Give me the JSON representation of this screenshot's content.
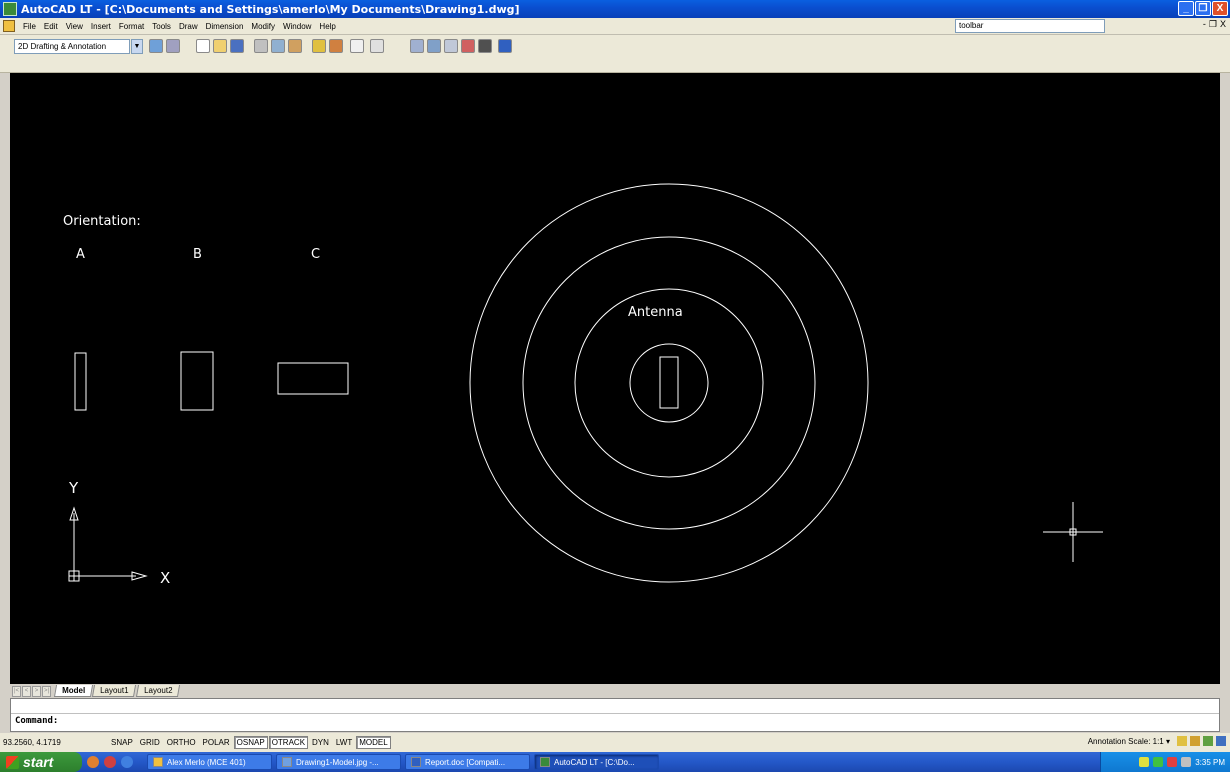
{
  "window": {
    "title": "AutoCAD LT - [C:\\Documents and Settings\\amerlo\\My Documents\\Drawing1.dwg]",
    "buttons": [
      "_",
      "❐",
      "X"
    ]
  },
  "menubar": {
    "items": [
      "File",
      "Edit",
      "View",
      "Insert",
      "Format",
      "Tools",
      "Draw",
      "Dimension",
      "Modify",
      "Window",
      "Help"
    ],
    "help_search_value": "toolbar",
    "doc_controls": [
      "-",
      "❐",
      "X"
    ]
  },
  "toolbar": {
    "workspace": "2D Drafting & Annotation"
  },
  "drawing": {
    "orientation_label": "Orientation:",
    "labels": [
      "A",
      "B",
      "C"
    ],
    "antenna_label": "Antenna",
    "ucs_y": "Y",
    "ucs_x": "X"
  },
  "layout_tabs": {
    "tabs": [
      "Model",
      "Layout1",
      "Layout2"
    ],
    "active": "Model"
  },
  "command": {
    "prompt": "Command:"
  },
  "statusbar": {
    "coordinates": "93.2560, 4.1719",
    "toggles": [
      {
        "label": "SNAP",
        "on": false
      },
      {
        "label": "GRID",
        "on": false
      },
      {
        "label": "ORTHO",
        "on": false
      },
      {
        "label": "POLAR",
        "on": false
      },
      {
        "label": "OSNAP",
        "on": true
      },
      {
        "label": "OTRACK",
        "on": true
      },
      {
        "label": "DYN",
        "on": false
      },
      {
        "label": "LWT",
        "on": false
      },
      {
        "label": "MODEL",
        "on": true
      }
    ],
    "annotation_scale": "Annotation Scale: 1:1 ▾"
  },
  "taskbar": {
    "start_label": "start",
    "tasks": [
      {
        "label": "Alex Merlo (MCE 401)",
        "active": false
      },
      {
        "label": "Drawing1-Model.jpg -...",
        "active": false
      },
      {
        "label": "Report.doc [Compati...",
        "active": false
      },
      {
        "label": "AutoCAD LT - [C:\\Do...",
        "active": true
      }
    ],
    "clock": "3:35 PM"
  },
  "colors": {
    "canvas_bg": "#000000",
    "geometry": "#ffffff",
    "titlebar": "#0a4fd0",
    "taskbar": "#2458c8",
    "start": "#2d7f2d"
  }
}
